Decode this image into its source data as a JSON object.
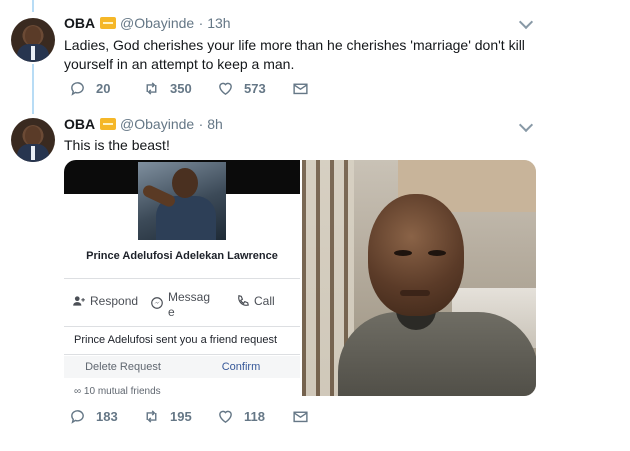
{
  "tweet1": {
    "name": "OBA",
    "handle": "@Obayinde",
    "time": "· 13h",
    "text": "Ladies, God cherishes your life more than he cherishes 'marriage' don't kill yourself in an attempt to keep a man.",
    "replies": "20",
    "retweets": "350",
    "likes": "573"
  },
  "tweet2": {
    "name": "OBA",
    "handle": "@Obayinde",
    "time": "· 8h",
    "text": "This is the beast!",
    "replies": "183",
    "retweets": "195",
    "likes": "118"
  },
  "fb_card": {
    "profile_name": "Prince Adelufosi Adelekan Lawrence",
    "respond_label": "Respond",
    "message_label_line1": "Messag",
    "message_label_line2": "e",
    "call_label": "Call",
    "request_text": "Prince Adelufosi sent you a friend request",
    "delete_label": "Delete Request",
    "confirm_label": "Confirm",
    "mutual_label": "10 mutual friends"
  },
  "colors": {
    "thread_line": "#b8dcf5",
    "secondary_text": "#657786",
    "fb_link": "#365899",
    "badge": "#f5b728"
  },
  "icons": [
    "reply-icon",
    "retweet-icon",
    "like-icon",
    "dm-icon",
    "chevron-down-icon",
    "verified-badge-icon",
    "add-friend-icon",
    "messenger-icon",
    "phone-icon"
  ]
}
